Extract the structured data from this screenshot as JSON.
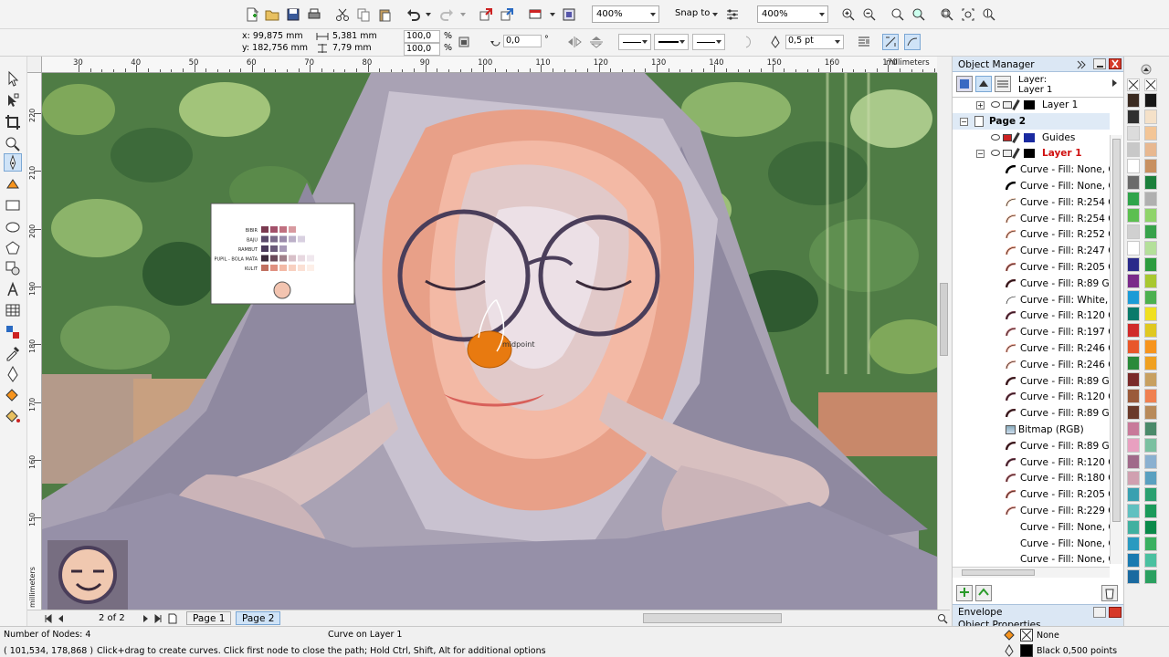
{
  "toolbar": {
    "zoom1": "400%",
    "snap_to": "Snap to",
    "zoom2": "400%"
  },
  "propbar": {
    "x": "x: 99,875 mm",
    "y": "y: 182,756 mm",
    "w": "5,381 mm",
    "h": "7,79 mm",
    "scale_w": "100,0",
    "scale_h": "100,0",
    "pct1": "%",
    "pct2": "%",
    "angle": "0,0",
    "deg": "°",
    "outline_width": "0,5 pt"
  },
  "ruler": {
    "unit": "millimeters",
    "unit_v": "millimeters",
    "h_labels": [
      "30",
      "40",
      "50",
      "60",
      "70",
      "80",
      "90",
      "100",
      "110",
      "120",
      "130",
      "140",
      "150",
      "160",
      "170"
    ],
    "v_labels": [
      "220",
      "210",
      "200",
      "190",
      "180",
      "170",
      "160",
      "150"
    ]
  },
  "legend_box": {
    "rows": [
      "BIBIR",
      "BAJU",
      "RAMBUT",
      "PUPIL - BOLA MATA",
      "KULIT"
    ]
  },
  "canvas_tooltip": "midpoint",
  "page_nav": {
    "counter": "2 of 2",
    "page1": "Page 1",
    "page2": "Page 2"
  },
  "object_manager": {
    "title": "Object Manager",
    "layer_label": "Layer:",
    "layer_name": "Layer 1",
    "tree": [
      {
        "text": "Layer 1",
        "kind": "layer",
        "color": "#000000"
      },
      {
        "text": "Page 2",
        "kind": "page"
      },
      {
        "text": "Guides",
        "kind": "guides",
        "color": "#1a2aa0"
      },
      {
        "text": "Layer 1",
        "kind": "layer-active",
        "color": "#000000"
      },
      {
        "text": "Curve - Fill: None, Outline: Black",
        "kind": "curve-none"
      },
      {
        "text": "Curve - Fill: None, Outline: Black",
        "kind": "curve-none"
      },
      {
        "text": "Curve - Fill: R:254 G:",
        "kind": "curve",
        "color": "#fee0cc"
      },
      {
        "text": "Curve - Fill: R:254 G:",
        "kind": "curve",
        "color": "#fec8b0"
      },
      {
        "text": "Curve - Fill: R:252 G:",
        "kind": "curve",
        "color": "#fcb8a0"
      },
      {
        "text": "Curve - Fill: R:247 G:",
        "kind": "curve",
        "color": "#f7a890"
      },
      {
        "text": "Curve - Fill: R:205 G:",
        "kind": "curve",
        "color": "#cd7a70"
      },
      {
        "text": "Curve - Fill: R:89 G:",
        "kind": "curve",
        "color": "#592a30"
      },
      {
        "text": "Curve - Fill: White, Outline",
        "kind": "curve",
        "color": "#ffffff"
      },
      {
        "text": "Curve - Fill: R:120 G:",
        "kind": "curve",
        "color": "#784050"
      },
      {
        "text": "Curve - Fill: R:197 G:",
        "kind": "curve",
        "color": "#c57a80"
      },
      {
        "text": "Curve - Fill: R:246 G:",
        "kind": "curve",
        "color": "#f6b0a0"
      },
      {
        "text": "Curve - Fill: R:246 G:",
        "kind": "curve",
        "color": "#f6c0b0"
      },
      {
        "text": "Curve - Fill: R:89 G:",
        "kind": "curve",
        "color": "#592a30"
      },
      {
        "text": "Curve - Fill: R:120 G:",
        "kind": "curve",
        "color": "#784050"
      },
      {
        "text": "Curve - Fill: R:89 G:",
        "kind": "curve",
        "color": "#592a30"
      },
      {
        "text": "Bitmap (RGB)",
        "kind": "bitmap"
      },
      {
        "text": "Curve - Fill: R:89 G:",
        "kind": "curve",
        "color": "#592a30"
      },
      {
        "text": "Curve - Fill: R:120 G:",
        "kind": "curve",
        "color": "#784050"
      },
      {
        "text": "Curve - Fill: R:180 G:",
        "kind": "curve",
        "color": "#b46a70"
      },
      {
        "text": "Curve - Fill: R:205 G:",
        "kind": "curve",
        "color": "#cd7a70"
      },
      {
        "text": "Curve - Fill: R:229 G:",
        "kind": "curve",
        "color": "#e59a90"
      },
      {
        "text": "Curve - Fill: None, Outline",
        "kind": "plain"
      },
      {
        "text": "Curve - Fill: None, Outline",
        "kind": "plain"
      },
      {
        "text": "Curve - Fill: None, Outline",
        "kind": "plain"
      }
    ],
    "envelope": "Envelope",
    "object_props": "Object Properties"
  },
  "palette": {
    "colors": [
      "#3a2a20",
      "#161616",
      "#303030",
      "#f5e1c8",
      "#dcdcdc",
      "#f3c596",
      "#c8c8c8",
      "#e8b890",
      "#ffffff",
      "#c89060",
      "#6a6a6a",
      "#1b7f3b",
      "#2fa44a",
      "#b0b0b0",
      "#5cbf50",
      "#8fd46a",
      "#d0d0d0",
      "#37a24a",
      "#ffffff",
      "#b4e09a",
      "#2a2a8a",
      "#2c9c3e",
      "#7a2a8a",
      "#a8c830",
      "#1c9bd6",
      "#4cb050",
      "#0a7a6a",
      "#f0e020",
      "#d02a2a",
      "#e0c820",
      "#e8572a",
      "#f7941d",
      "#2a8a3a",
      "#f0a020",
      "#7a2a2a",
      "#c8a060",
      "#9a5a3a",
      "#f08050",
      "#6a3a2a",
      "#b88a5a",
      "#c87a9a",
      "#4a8a6a",
      "#e8a0c0",
      "#7ac0a0",
      "#a06a8a",
      "#8ab0d0",
      "#d0a0b0",
      "#5aa0c0",
      "#3aa0b0",
      "#2aa070",
      "#60c0c0",
      "#1a9a5a",
      "#40b0a0",
      "#0a8a4a",
      "#2a9ac0",
      "#3ab060",
      "#1a7ab0",
      "#4ac0a0",
      "#1a6aa0",
      "#2aa060"
    ]
  },
  "status": {
    "nodes": "Number of Nodes: 4",
    "object": "Curve on Layer 1",
    "coords": "( 101,534, 178,868 )",
    "hint": "Click+drag to create curves. Click first node to close the path; Hold Ctrl, Shift, Alt for additional options",
    "fill": "None",
    "outline": "Black  0,500 points"
  }
}
